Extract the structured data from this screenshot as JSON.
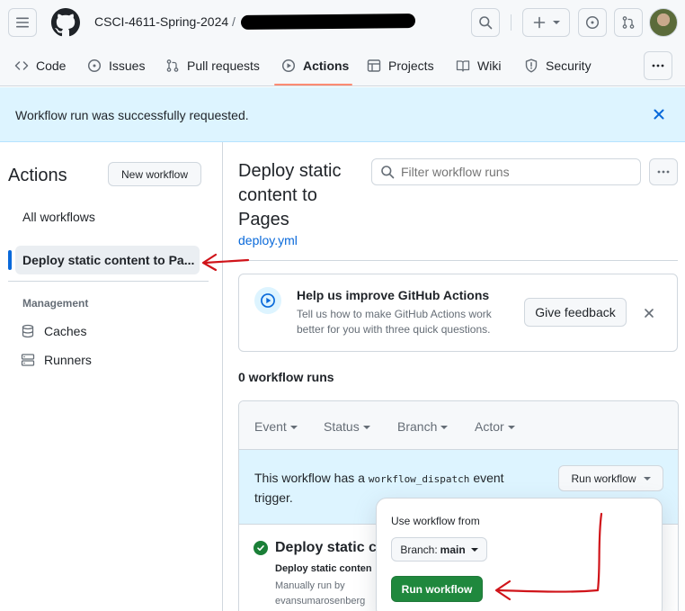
{
  "header": {
    "repo_owner": "CSCI-4611-Spring-2024",
    "separator": "/"
  },
  "nav": {
    "tabs": [
      {
        "label": "Code",
        "icon": "code-icon"
      },
      {
        "label": "Issues",
        "icon": "issue-icon"
      },
      {
        "label": "Pull requests",
        "icon": "pull-request-icon"
      },
      {
        "label": "Actions",
        "icon": "play-icon",
        "active": true
      },
      {
        "label": "Projects",
        "icon": "table-icon"
      },
      {
        "label": "Wiki",
        "icon": "book-icon"
      },
      {
        "label": "Security",
        "icon": "shield-icon"
      }
    ]
  },
  "flash": {
    "message": "Workflow run was successfully requested."
  },
  "sidebar": {
    "title": "Actions",
    "new_workflow": "New workflow",
    "all_workflows": "All workflows",
    "active_workflow": "Deploy static content to Pa...",
    "management_heading": "Management",
    "caches": "Caches",
    "runners": "Runners"
  },
  "main": {
    "title": "Deploy static content to Pages",
    "file": "deploy.yml",
    "filter_placeholder": "Filter workflow runs",
    "feedback": {
      "title": "Help us improve GitHub Actions",
      "description": "Tell us how to make GitHub Actions work better for you with three quick questions.",
      "button": "Give feedback"
    },
    "runs_count": "0 workflow runs",
    "filters": [
      "Event",
      "Status",
      "Branch",
      "Actor"
    ],
    "dispatch": {
      "text_before": "This workflow has a",
      "code": "workflow_dispatch",
      "text_after": "event trigger.",
      "button": "Run workflow"
    },
    "run_row": {
      "title": "Deploy static co",
      "subtitle": "Deploy static conten",
      "meta_line1": "Manually run by",
      "meta_line2": "evansumarosenberg"
    }
  },
  "popover": {
    "label": "Use workflow from",
    "branch_prefix": "Branch:",
    "branch": "main",
    "run_button": "Run workflow"
  },
  "colors": {
    "accent": "#0969da",
    "primary_button": "#1f883d",
    "flash_bg": "#ddf4ff",
    "annotation": "#d0141a"
  }
}
